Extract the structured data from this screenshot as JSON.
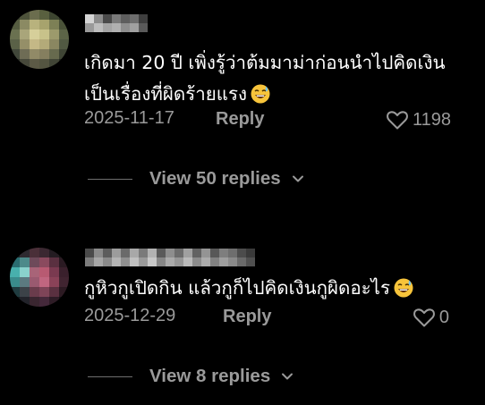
{
  "colors": {
    "background": "#000000",
    "text_primary": "#ffffff",
    "text_secondary": "#9a9a9a",
    "divider": "#6e6e6e"
  },
  "comments": [
    {
      "username_censored": true,
      "avatar_censored": true,
      "text_line1": "เกิดมา 20 ปี เพิ่งรู้ว่าต้มมาม่าก่อนนำไปคิดเงิน",
      "text_line2": "เป็นเรื่องที่ผิดร้ายแรง",
      "emoji": "grinning-face-with-sweat",
      "date": "2025-11-17",
      "reply_label": "Reply",
      "like_icon": "heart-outline-icon",
      "likes": "1198",
      "view_replies_label": "View 50 replies",
      "view_replies_icon": "chevron-down-icon"
    },
    {
      "username_censored": true,
      "avatar_censored": true,
      "text_line1": "กูหิวกูเปิดกิน แล้วกูก็ไปคิดเงินกูผิดอะไร",
      "emoji": "grinning-face-with-sweat",
      "date": "2025-12-29",
      "reply_label": "Reply",
      "like_icon": "heart-outline-icon",
      "likes": "0",
      "view_replies_label": "View 8 replies",
      "view_replies_icon": "chevron-down-icon"
    }
  ]
}
